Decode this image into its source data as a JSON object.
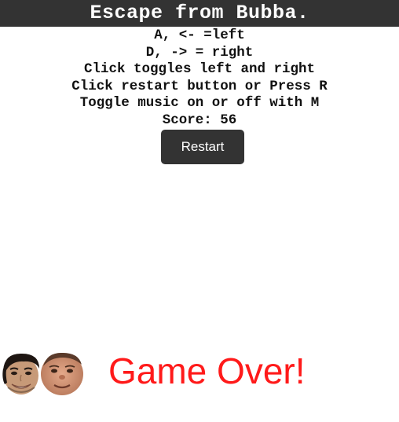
{
  "header": {
    "title": "Escape from Bubba."
  },
  "instructions": {
    "lines": [
      "A, <- =left",
      "D, -> = right",
      "Click toggles left and right",
      "Click restart button or Press R",
      "Toggle music on or off with M"
    ],
    "score_label": "Score:",
    "score_value": 56
  },
  "controls": {
    "restart_label": "Restart"
  },
  "game": {
    "status_text": "Game Over!",
    "status_color": "#ff1a1a",
    "player_sprite": "player-face-icon",
    "enemy_sprite": "bubba-face-icon"
  }
}
